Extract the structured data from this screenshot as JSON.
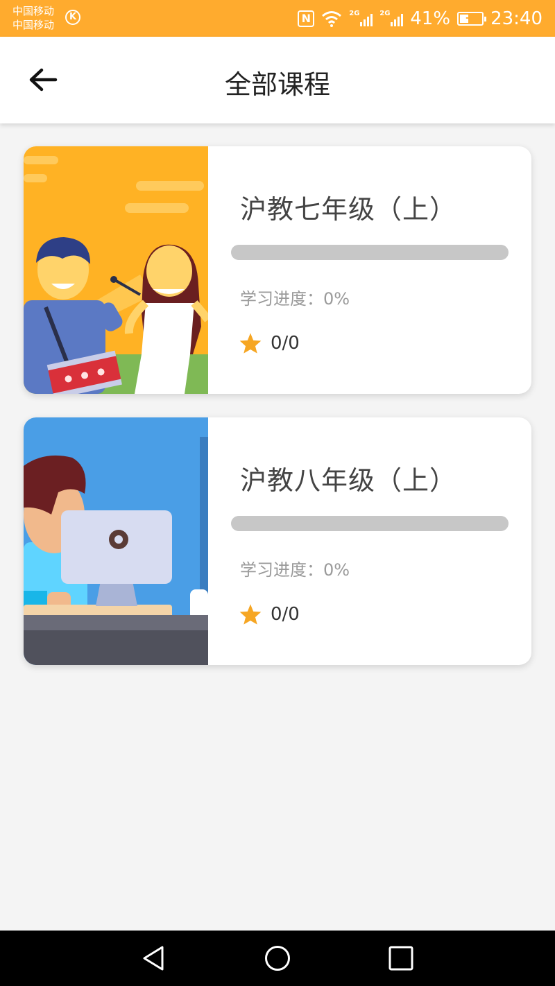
{
  "status_bar": {
    "carrier_1": "中国移动",
    "carrier_2": "中国移动",
    "k_badge": "K",
    "nfc": "N",
    "signal_tag_1": "2G",
    "signal_tag_2": "2G",
    "battery_text": "41%",
    "battery_level": 0.41,
    "time": "23:40",
    "background": "#ffab2e"
  },
  "app_bar": {
    "title": "全部课程",
    "back_icon": "arrow-left-icon"
  },
  "courses": [
    {
      "title": "沪教七年级（上）",
      "progress_label": "学习进度：0%",
      "progress": 0,
      "rating": "0/0",
      "thumbnail": "musicians-illustration"
    },
    {
      "title": "沪教八年级（上）",
      "progress_label": "学习进度：0%",
      "progress": 0,
      "rating": "0/0",
      "thumbnail": "computer-user-illustration"
    }
  ],
  "nav_bar": {
    "back_icon": "triangle-back-icon",
    "home_icon": "circle-home-icon",
    "recents_icon": "square-recents-icon"
  },
  "colors": {
    "accent": "#ffab2e",
    "page_bg": "#f4f4f4",
    "progress_track": "#c7c7c7",
    "star": "#f6a623"
  }
}
